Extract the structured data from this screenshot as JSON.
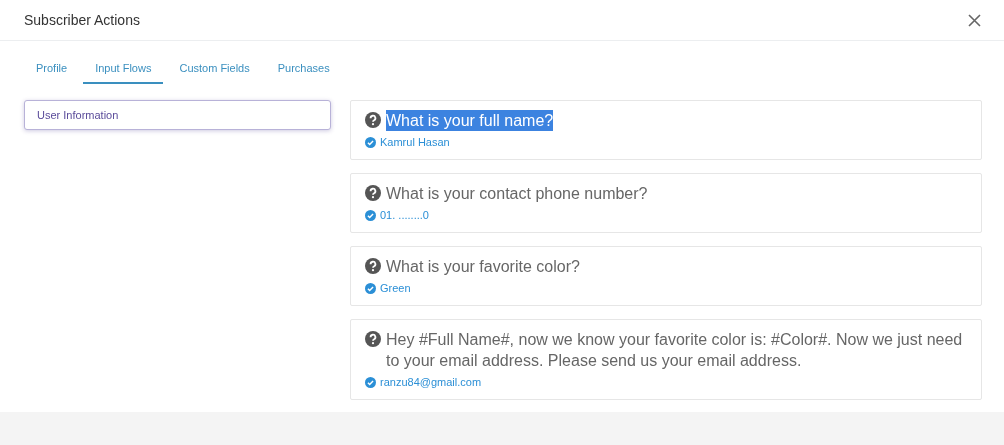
{
  "window": {
    "title": "Subscriber Actions"
  },
  "tabs": [
    {
      "label": "Profile",
      "selected": false
    },
    {
      "label": "Input Flows",
      "selected": true
    },
    {
      "label": "Custom Fields",
      "selected": false
    },
    {
      "label": "Purchases",
      "selected": false
    }
  ],
  "flows": [
    {
      "label": "User Information",
      "selected": true
    }
  ],
  "questions": [
    {
      "question": "What is your full name?",
      "answer": "Kamrul Hasan",
      "highlighted": true
    },
    {
      "question": "What is your contact phone number?",
      "answer": "01. ........0",
      "highlighted": false
    },
    {
      "question": "What is your favorite color?",
      "answer": "Green",
      "highlighted": false
    },
    {
      "question": "Hey #Full Name#, now we know your favorite color is: #Color#. Now we just need to your email address. Please send us your email address.",
      "answer": "ranzu84@gmail.com",
      "highlighted": false
    }
  ]
}
